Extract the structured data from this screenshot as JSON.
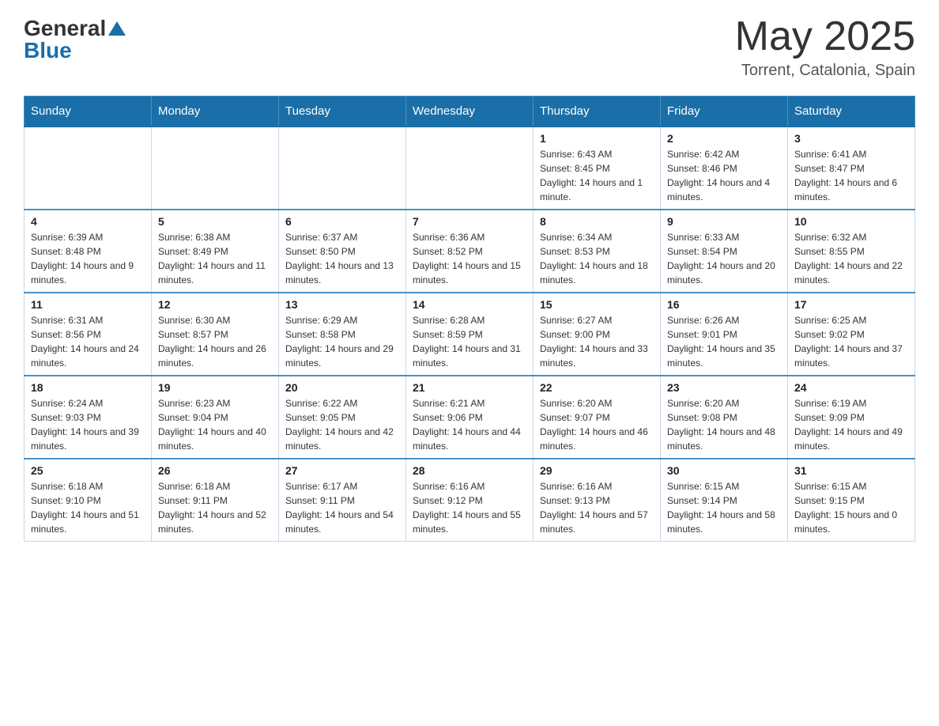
{
  "header": {
    "logo": {
      "general": "General",
      "blue": "Blue"
    },
    "title": "May 2025",
    "subtitle": "Torrent, Catalonia, Spain"
  },
  "calendar": {
    "days_of_week": [
      "Sunday",
      "Monday",
      "Tuesday",
      "Wednesday",
      "Thursday",
      "Friday",
      "Saturday"
    ],
    "weeks": [
      [
        {
          "day": "",
          "info": ""
        },
        {
          "day": "",
          "info": ""
        },
        {
          "day": "",
          "info": ""
        },
        {
          "day": "",
          "info": ""
        },
        {
          "day": "1",
          "info": "Sunrise: 6:43 AM\nSunset: 8:45 PM\nDaylight: 14 hours and 1 minute."
        },
        {
          "day": "2",
          "info": "Sunrise: 6:42 AM\nSunset: 8:46 PM\nDaylight: 14 hours and 4 minutes."
        },
        {
          "day": "3",
          "info": "Sunrise: 6:41 AM\nSunset: 8:47 PM\nDaylight: 14 hours and 6 minutes."
        }
      ],
      [
        {
          "day": "4",
          "info": "Sunrise: 6:39 AM\nSunset: 8:48 PM\nDaylight: 14 hours and 9 minutes."
        },
        {
          "day": "5",
          "info": "Sunrise: 6:38 AM\nSunset: 8:49 PM\nDaylight: 14 hours and 11 minutes."
        },
        {
          "day": "6",
          "info": "Sunrise: 6:37 AM\nSunset: 8:50 PM\nDaylight: 14 hours and 13 minutes."
        },
        {
          "day": "7",
          "info": "Sunrise: 6:36 AM\nSunset: 8:52 PM\nDaylight: 14 hours and 15 minutes."
        },
        {
          "day": "8",
          "info": "Sunrise: 6:34 AM\nSunset: 8:53 PM\nDaylight: 14 hours and 18 minutes."
        },
        {
          "day": "9",
          "info": "Sunrise: 6:33 AM\nSunset: 8:54 PM\nDaylight: 14 hours and 20 minutes."
        },
        {
          "day": "10",
          "info": "Sunrise: 6:32 AM\nSunset: 8:55 PM\nDaylight: 14 hours and 22 minutes."
        }
      ],
      [
        {
          "day": "11",
          "info": "Sunrise: 6:31 AM\nSunset: 8:56 PM\nDaylight: 14 hours and 24 minutes."
        },
        {
          "day": "12",
          "info": "Sunrise: 6:30 AM\nSunset: 8:57 PM\nDaylight: 14 hours and 26 minutes."
        },
        {
          "day": "13",
          "info": "Sunrise: 6:29 AM\nSunset: 8:58 PM\nDaylight: 14 hours and 29 minutes."
        },
        {
          "day": "14",
          "info": "Sunrise: 6:28 AM\nSunset: 8:59 PM\nDaylight: 14 hours and 31 minutes."
        },
        {
          "day": "15",
          "info": "Sunrise: 6:27 AM\nSunset: 9:00 PM\nDaylight: 14 hours and 33 minutes."
        },
        {
          "day": "16",
          "info": "Sunrise: 6:26 AM\nSunset: 9:01 PM\nDaylight: 14 hours and 35 minutes."
        },
        {
          "day": "17",
          "info": "Sunrise: 6:25 AM\nSunset: 9:02 PM\nDaylight: 14 hours and 37 minutes."
        }
      ],
      [
        {
          "day": "18",
          "info": "Sunrise: 6:24 AM\nSunset: 9:03 PM\nDaylight: 14 hours and 39 minutes."
        },
        {
          "day": "19",
          "info": "Sunrise: 6:23 AM\nSunset: 9:04 PM\nDaylight: 14 hours and 40 minutes."
        },
        {
          "day": "20",
          "info": "Sunrise: 6:22 AM\nSunset: 9:05 PM\nDaylight: 14 hours and 42 minutes."
        },
        {
          "day": "21",
          "info": "Sunrise: 6:21 AM\nSunset: 9:06 PM\nDaylight: 14 hours and 44 minutes."
        },
        {
          "day": "22",
          "info": "Sunrise: 6:20 AM\nSunset: 9:07 PM\nDaylight: 14 hours and 46 minutes."
        },
        {
          "day": "23",
          "info": "Sunrise: 6:20 AM\nSunset: 9:08 PM\nDaylight: 14 hours and 48 minutes."
        },
        {
          "day": "24",
          "info": "Sunrise: 6:19 AM\nSunset: 9:09 PM\nDaylight: 14 hours and 49 minutes."
        }
      ],
      [
        {
          "day": "25",
          "info": "Sunrise: 6:18 AM\nSunset: 9:10 PM\nDaylight: 14 hours and 51 minutes."
        },
        {
          "day": "26",
          "info": "Sunrise: 6:18 AM\nSunset: 9:11 PM\nDaylight: 14 hours and 52 minutes."
        },
        {
          "day": "27",
          "info": "Sunrise: 6:17 AM\nSunset: 9:11 PM\nDaylight: 14 hours and 54 minutes."
        },
        {
          "day": "28",
          "info": "Sunrise: 6:16 AM\nSunset: 9:12 PM\nDaylight: 14 hours and 55 minutes."
        },
        {
          "day": "29",
          "info": "Sunrise: 6:16 AM\nSunset: 9:13 PM\nDaylight: 14 hours and 57 minutes."
        },
        {
          "day": "30",
          "info": "Sunrise: 6:15 AM\nSunset: 9:14 PM\nDaylight: 14 hours and 58 minutes."
        },
        {
          "day": "31",
          "info": "Sunrise: 6:15 AM\nSunset: 9:15 PM\nDaylight: 15 hours and 0 minutes."
        }
      ]
    ]
  }
}
